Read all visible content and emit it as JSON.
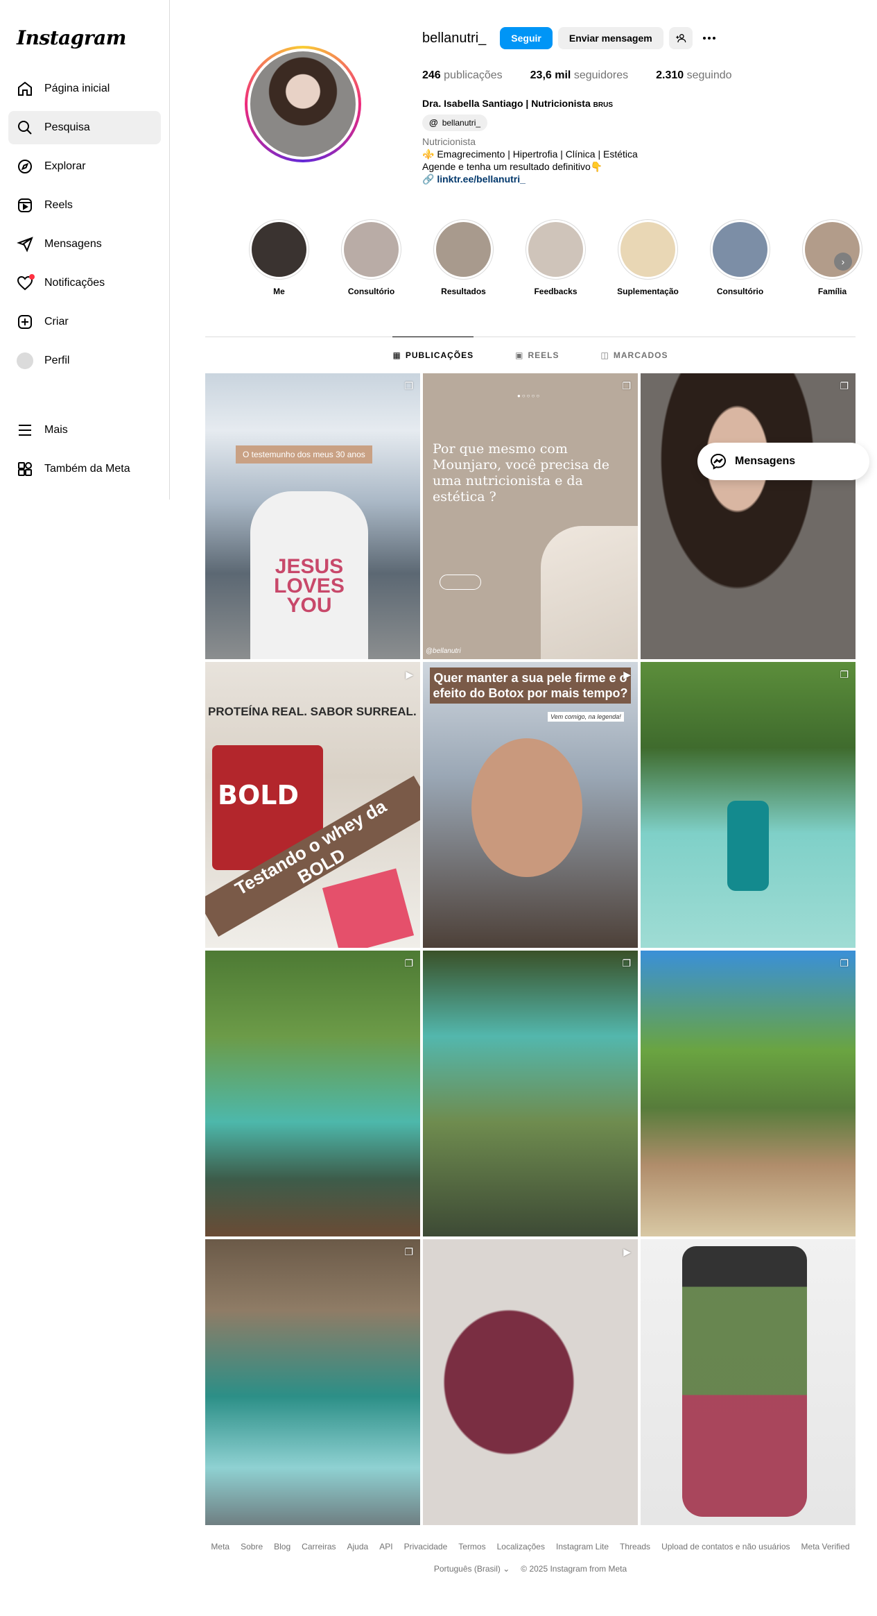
{
  "app": {
    "logo": "Instagram"
  },
  "sidebar": {
    "items": [
      {
        "label": "Página inicial",
        "icon": "home-icon"
      },
      {
        "label": "Pesquisa",
        "icon": "search-icon"
      },
      {
        "label": "Explorar",
        "icon": "compass-icon"
      },
      {
        "label": "Reels",
        "icon": "reels-icon"
      },
      {
        "label": "Mensagens",
        "icon": "send-icon"
      },
      {
        "label": "Notificações",
        "icon": "heart-icon"
      },
      {
        "label": "Criar",
        "icon": "plus-icon"
      },
      {
        "label": "Perfil",
        "icon": "avatar"
      }
    ],
    "bottom": [
      {
        "label": "Mais",
        "icon": "menu-icon"
      },
      {
        "label": "Também da Meta",
        "icon": "meta-apps-icon"
      }
    ]
  },
  "profile": {
    "username": "bellanutri_",
    "follow_label": "Seguir",
    "message_label": "Enviar mensagem",
    "stats": {
      "posts_value": "246",
      "posts_label": "publicações",
      "followers_value": "23,6 mil",
      "followers_label": "seguidores",
      "following_value": "2.310",
      "following_label": "seguindo"
    },
    "full_name": "Dra. Isabella Santiago | Nutricionista",
    "full_name_suffix": "BRUS",
    "threads_handle": "bellanutri_",
    "threads_glyph": "@",
    "category": "Nutricionista",
    "bio_line1": "⚜️ Emagrecimento | Hipertrofia | Clínica | Estética",
    "bio_line2": "Agende e tenha um resultado definitivo👇",
    "link": "linktr.ee/bellanutri_",
    "link_glyph": "🔗"
  },
  "highlights": [
    {
      "label": "Me",
      "color": "#3a3330"
    },
    {
      "label": "Consultório",
      "color": "#b9aca6"
    },
    {
      "label": "Resultados",
      "color": "#a89a8d"
    },
    {
      "label": "Feedbacks",
      "color": "#cfc4ba"
    },
    {
      "label": "Suplementação",
      "color": "#e9d7b5"
    },
    {
      "label": "Consultório",
      "color": "#7c8ea6"
    },
    {
      "label": "Família",
      "color": "#b29c8a"
    }
  ],
  "tabs": [
    {
      "label": "PUBLICAÇÕES",
      "glyph": "▦"
    },
    {
      "label": "REELS",
      "glyph": "▣"
    },
    {
      "label": "MARCADOS",
      "glyph": "◫"
    }
  ],
  "posts": {
    "p1_tag": "O testemunho dos meus 30 anos",
    "p1_shirt": "JESUS LOVES YOU",
    "p2_text": "Por que mesmo com Mounjaro, você precisa de uma nutricionista e da estética ?",
    "p2_handle": "@bellanutri",
    "p2_dots": "●○○○○",
    "p4_protein": "PROTEÍNA REAL. SABOR SURREAL.",
    "p4_brand": "BOLD",
    "p4_band": "Testando o whey da BOLD",
    "p5_headline": "Quer manter a sua pele firme e o efeito do Botox por mais tempo?",
    "p5_sub": "Vem comigo, na legenda!",
    "carousel_glyph": "❐",
    "reel_glyph": "▶"
  },
  "floating": {
    "messages_label": "Mensagens"
  },
  "footer": {
    "links": [
      "Meta",
      "Sobre",
      "Blog",
      "Carreiras",
      "Ajuda",
      "API",
      "Privacidade",
      "Termos",
      "Localizações",
      "Instagram Lite",
      "Threads",
      "Upload de contatos e não usuários",
      "Meta Verified"
    ],
    "language": "Português (Brasil) ⌄",
    "copyright": "© 2025 Instagram from Meta"
  },
  "colors": {
    "accent": "#0095f6",
    "link": "#00376b",
    "notification_dot": "#ff3040"
  }
}
